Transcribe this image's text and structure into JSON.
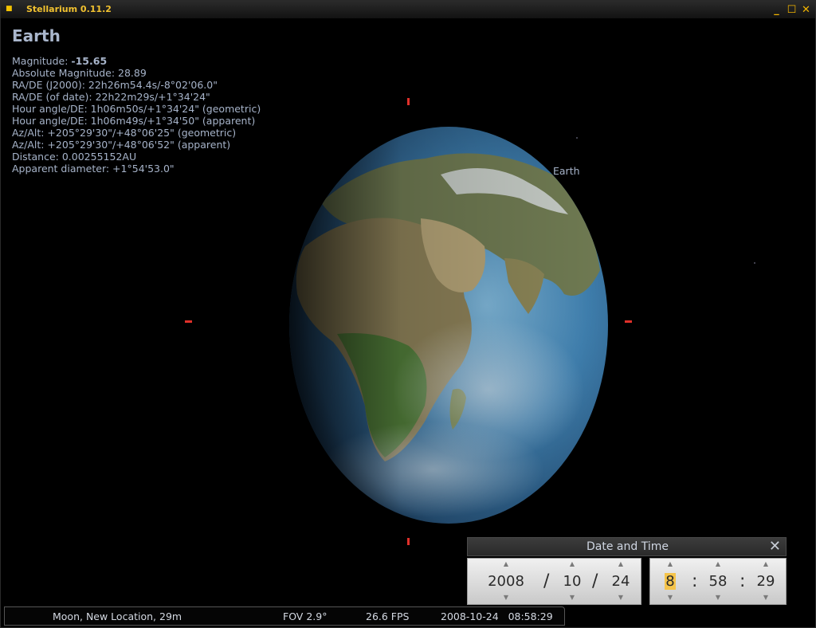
{
  "window": {
    "title": "Stellarium 0.11.2",
    "icon": "app-icon",
    "minimize_glyph": "_",
    "maximize_glyph": "☐",
    "close_glyph": "✕"
  },
  "info": {
    "name": "Earth",
    "magnitude_label": "Magnitude: ",
    "magnitude_value": "-15.65",
    "lines": [
      "Absolute Magnitude: 28.89",
      "RA/DE (J2000): 22h26m54.4s/-8°02'06.0\"",
      "RA/DE (of date): 22h22m29s/+1°34'24\"",
      "Hour angle/DE: 1h06m50s/+1°34'24\" (geometric)",
      "Hour angle/DE: 1h06m49s/+1°34'50\" (apparent)",
      "Az/Alt: +205°29'30\"/+48°06'25\" (geometric)",
      "Az/Alt: +205°29'30\"/+48°06'52\" (apparent)",
      "Distance: 0.00255152AU",
      "Apparent diameter: +1°54'53.0\""
    ]
  },
  "sky_label": "Earth",
  "datetime_dialog": {
    "title": "Date and Time",
    "close_glyph": "✕",
    "year": "2008",
    "month": "10",
    "day": "24",
    "hour": "8",
    "minute": "58",
    "second": "29",
    "date_sep": "/",
    "time_sep": ":",
    "up_glyph": "▲",
    "down_glyph": "▼"
  },
  "statusbar": {
    "location": "Moon, New Location, 29m",
    "fov": "FOV 2.9°",
    "fps": "26.6 FPS",
    "datetime": "2008-10-24   08:58:29"
  },
  "colors": {
    "title_accent": "#f2c230",
    "info_text": "#a6b3c9",
    "marker_red": "#e0302a"
  }
}
